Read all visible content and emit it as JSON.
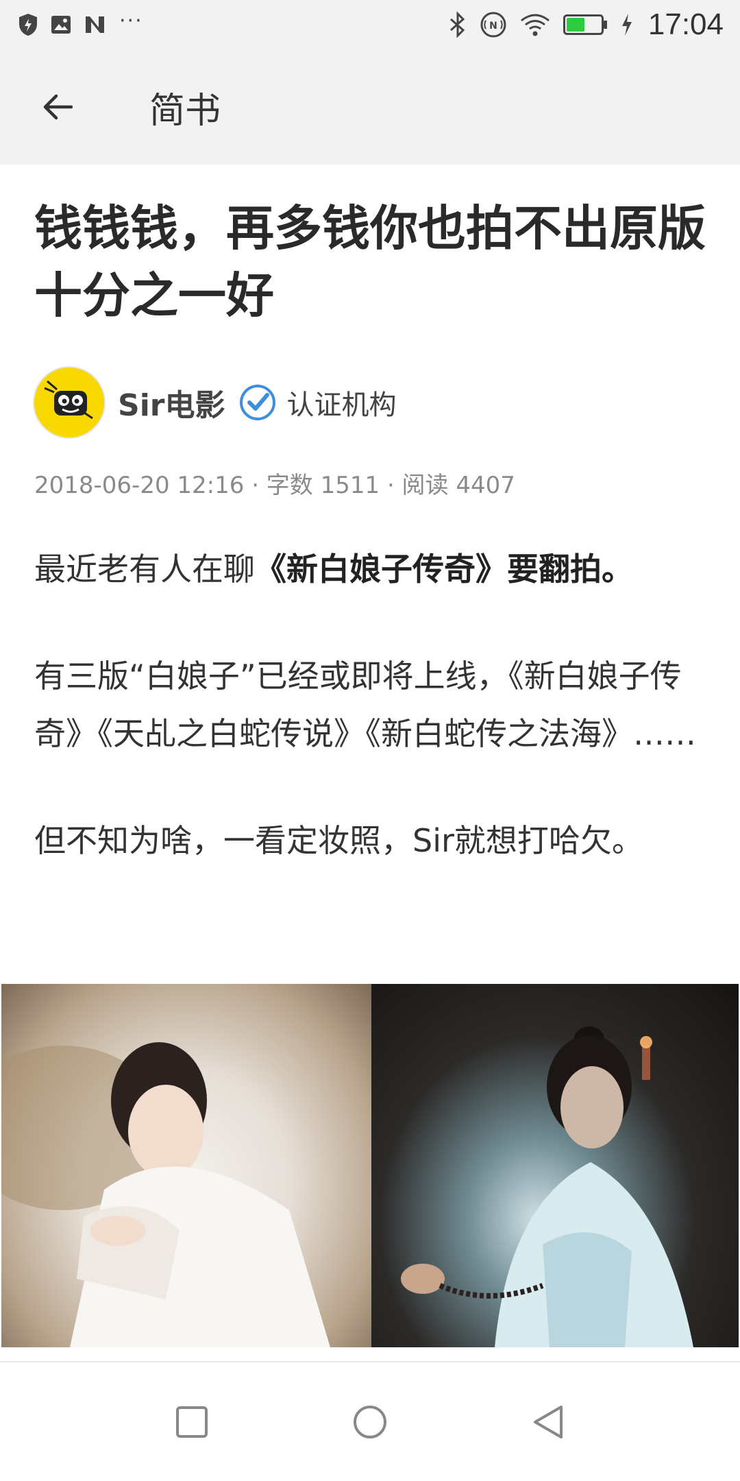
{
  "status_bar": {
    "time": "17:04",
    "more": "···",
    "left_icons": [
      "shield-icon",
      "image-icon",
      "n-logo-icon"
    ],
    "right_icons": [
      "bluetooth-icon",
      "nfc-icon",
      "wifi-icon",
      "battery-icon",
      "charging-icon"
    ],
    "battery_level": 0.55,
    "battery_color": "#2ecc40"
  },
  "app_bar": {
    "title": "简书",
    "back_icon": "arrow-left-icon"
  },
  "article": {
    "title": "钱钱钱，再多钱你也拍不出原版十分之一好",
    "author": {
      "name": "Sir电影",
      "verified_label": "认证机构",
      "avatar_color": "#f7d800",
      "verify_color": "#3e8ede"
    },
    "meta": {
      "text": "2018-06-20 12:16 · 字数 1511 · 阅读 4407"
    },
    "paragraphs": {
      "p1_prefix": "最近老有人在聊",
      "p1_bold": "《新白娘子传奇》要翻拍。",
      "p2": "有三版“白娘子”已经或即将上线，《新白娘子传奇》《天乩之白蛇传说》《新白蛇传之法海》……",
      "p3": "但不知为啥，一看定妆照，Sir就想打哈欠。"
    }
  },
  "nav_bar": {
    "icons": [
      "recent-apps-icon",
      "home-icon",
      "back-triangle-icon"
    ]
  }
}
